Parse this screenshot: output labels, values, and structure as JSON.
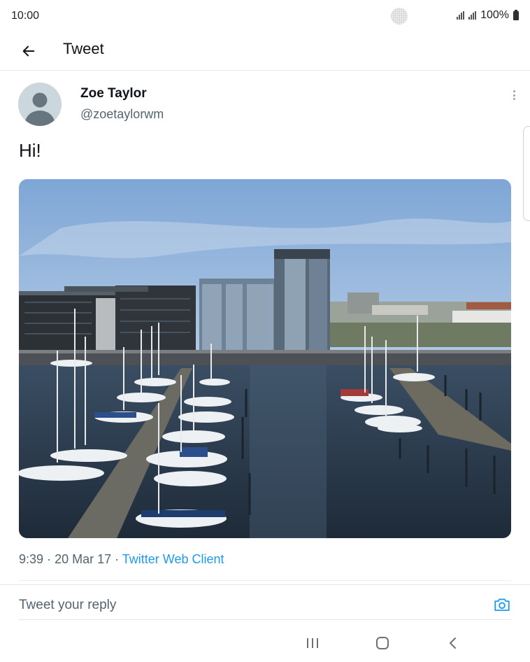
{
  "status_bar": {
    "time": "10:00",
    "battery": "100%"
  },
  "header": {
    "title": "Tweet",
    "back_icon": "arrow-left-icon"
  },
  "tweet": {
    "author_name": "Zoe Taylor",
    "author_handle": "@zoetaylorwm",
    "text": "Hi!",
    "time": "9:39",
    "date": "20 Mar 17",
    "source": "Twitter Web Client"
  },
  "reply": {
    "placeholder": "Tweet your reply",
    "camera_icon": "camera-icon"
  },
  "colors": {
    "link": "#1d9bf0",
    "secondary_text": "#536471",
    "primary_text": "#0f1419"
  }
}
